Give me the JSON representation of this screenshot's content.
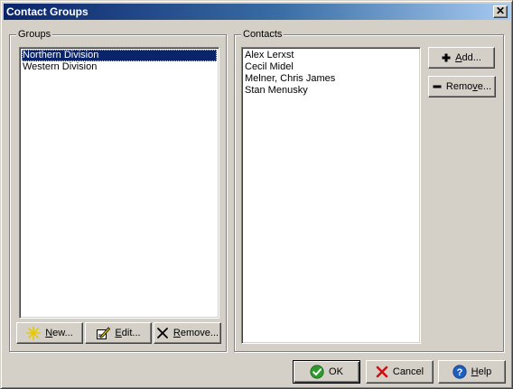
{
  "window": {
    "title": "Contact Groups",
    "close_symbol": "✕"
  },
  "groups": {
    "legend": "Groups",
    "items": [
      {
        "label": "Northern Division",
        "selected": true
      },
      {
        "label": "Western Division",
        "selected": false
      }
    ],
    "buttons": {
      "new": {
        "mnemonic": "N",
        "rest": "ew..."
      },
      "edit": {
        "mnemonic": "E",
        "rest": "dit..."
      },
      "remove": {
        "mnemonic": "R",
        "rest": "emove..."
      }
    }
  },
  "contacts": {
    "legend": "Contacts",
    "items": [
      {
        "label": "Alex Lerxst"
      },
      {
        "label": "Cecil Midel"
      },
      {
        "label": "Melner, Chris James"
      },
      {
        "label": "Stan Menusky"
      }
    ],
    "buttons": {
      "add": {
        "mnemonic": "A",
        "rest": "dd..."
      },
      "remove": {
        "pre": "Remo",
        "mnemonic": "v",
        "rest": "e..."
      }
    }
  },
  "footer": {
    "ok": "OK",
    "cancel": "Cancel",
    "help": {
      "mnemonic": "H",
      "rest": "elp"
    }
  },
  "icons": {
    "new": "sparkle-icon",
    "edit": "edit-pencil-icon",
    "remove": "x-icon",
    "add": "plus-icon",
    "remove_contact": "minus-icon",
    "ok": "green-check-icon",
    "cancel": "red-x-icon",
    "help": "help-question-icon"
  },
  "colors": {
    "selection": "#0a246a",
    "ok_green": "#2e9a2e",
    "cancel_red": "#d01010",
    "help_blue": "#1f5fbf"
  }
}
